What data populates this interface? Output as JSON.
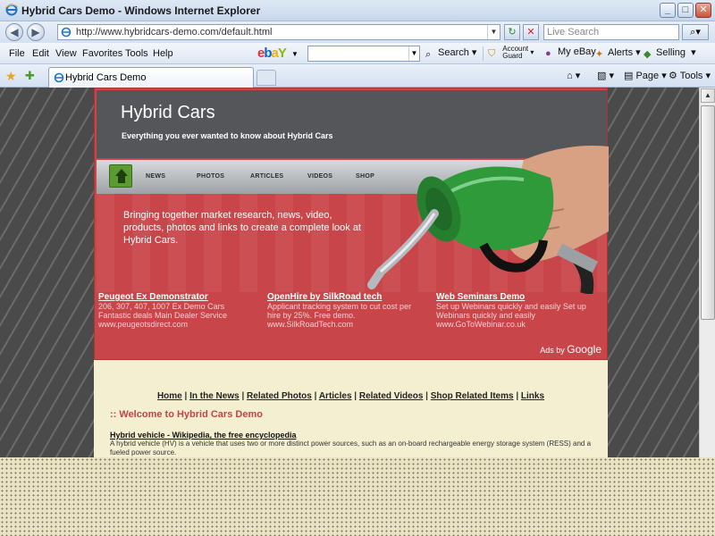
{
  "window": {
    "title": "Hybrid Cars Demo - Windows Internet Explorer",
    "buttons": {
      "minimize": "_",
      "maximize": "□",
      "close": "✕"
    }
  },
  "address_bar": {
    "url": "http://www.hybridcars-demo.com/default.html",
    "live_search_placeholder": "Live Search"
  },
  "menu": {
    "items": [
      "File",
      "Edit",
      "View",
      "Favorites",
      "Tools",
      "Help"
    ]
  },
  "ebay_toolbar": {
    "search_label": "Search",
    "account_guard_line1": "Account",
    "account_guard_line2": "Guard",
    "my_ebay": "My eBay",
    "alerts": "Alerts",
    "selling": "Selling"
  },
  "tabs": {
    "active_label": "Hybrid Cars Demo"
  },
  "command_bar": {
    "page": "Page",
    "tools": "Tools"
  },
  "site": {
    "title": "Hybrid Cars",
    "tagline": "Everything you ever wanted to know about Hybrid Cars",
    "nav": [
      "NEWS",
      "PHOTOS",
      "ARTICLES",
      "VIDEOS",
      "SHOP"
    ],
    "intro": "Bringing together market research, news, video, products, photos and links to create a complete look at Hybrid Cars.",
    "ads": [
      {
        "title": "Peugeot Ex Demonstrator",
        "line1": "206, 307, 407, 1007 Ex Demo Cars",
        "line2": "Fantastic deals Main Dealer Service",
        "url": "www.peugeotsdirect.com"
      },
      {
        "title": "OpenHire by SilkRoad tech",
        "line1": "Applicant tracking system to cut cost per",
        "line2": "hire by 25%. Free demo.",
        "url": "www.SilkRoadTech.com"
      },
      {
        "title": "Web Seminars Demo",
        "line1": "Set up Webinars quickly and easily Set up",
        "line2": "Webinars quickly and easily",
        "url": "www.GoToWebinar.co.uk"
      }
    ],
    "ads_by": "Ads by",
    "ads_by_google": "Google",
    "links": [
      "Home",
      "In the News",
      "Related Photos",
      "Articles",
      "Related Videos",
      "Shop Related Items",
      "Links"
    ],
    "welcome": ":: Welcome to Hybrid Cars Demo",
    "article_title": "Hybrid vehicle - Wikipedia, the free encyclopedia",
    "article_text": "A hybrid vehicle (HV) is a vehicle that uses two or more distinct power sources, such as an on-board rechargeable energy storage system (RESS) and a fueled power source."
  },
  "colors": {
    "header_red": "#c8464a",
    "header_dark": "#545659",
    "pump_green": "#2f9a3a",
    "welcome_red": "#c34444"
  }
}
